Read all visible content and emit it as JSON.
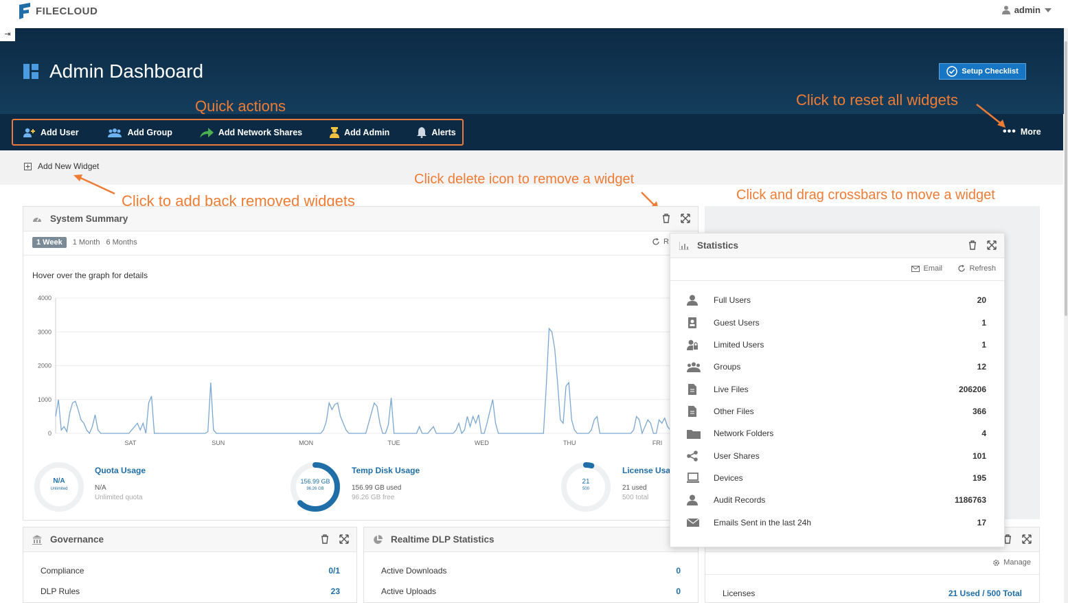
{
  "app": {
    "logo_text": "FILECLOUD",
    "user": "admin"
  },
  "hero": {
    "title": "Admin Dashboard",
    "setup_label": "Setup Checklist"
  },
  "quick_actions": [
    {
      "label": "Add User",
      "icon": "add-user-icon"
    },
    {
      "label": "Add Group",
      "icon": "add-group-icon"
    },
    {
      "label": "Add Network Shares",
      "icon": "network-share-icon"
    },
    {
      "label": "Add Admin",
      "icon": "admin-icon"
    },
    {
      "label": "Alerts",
      "icon": "bell-icon"
    }
  ],
  "more_label": "More",
  "add_widget_label": "Add New Widget",
  "annotations": {
    "quick_actions": "Quick actions",
    "reset": "Click to reset all widgets",
    "delete": "Click delete icon to remove a widget",
    "add_back": "Click to add back removed widgets",
    "drag": "Click and drag crossbars to move a widget"
  },
  "system_summary": {
    "title": "System Summary",
    "tabs": [
      "1 Week",
      "1 Month",
      "6 Months"
    ],
    "refresh_label": "R",
    "hover_note": "Hover over the graph for details",
    "gauges": [
      {
        "title": "Quota Usage",
        "center": "N/A",
        "center_sub": "Unlimited",
        "line1": "N/A",
        "line2": "Unlimited quota",
        "fraction": 0
      },
      {
        "title": "Temp Disk Usage",
        "center": "156.99 GB",
        "center_sub": "96.26 GB",
        "line1": "156.99 GB used",
        "line2": "96.26 GB free",
        "fraction": 0.62
      },
      {
        "title": "License Usa",
        "center": "21",
        "center_sub": "500",
        "line1": "21 used",
        "line2": "500 total",
        "fraction": 0.042
      }
    ]
  },
  "chart_data": {
    "type": "line",
    "title": "",
    "xlabel": "",
    "ylabel": "",
    "ylim": [
      0,
      4000
    ],
    "yticks": [
      0,
      1000,
      2000,
      3000,
      4000
    ],
    "xticks": [
      "SAT",
      "SUN",
      "MON",
      "TUE",
      "WED",
      "THU",
      "FRI"
    ],
    "color": "#7aa7d2",
    "grid": true,
    "series": [
      {
        "values": [
          500,
          1000,
          100,
          200,
          50,
          600,
          900,
          950,
          700,
          400,
          300,
          100,
          0,
          200,
          550,
          100,
          0,
          0,
          0,
          0,
          0,
          0,
          0,
          0,
          0,
          0,
          0,
          100,
          200,
          300,
          100,
          300,
          0,
          900,
          1100,
          0,
          0,
          0,
          0,
          0,
          0,
          0,
          0,
          0,
          0,
          0,
          0,
          0,
          0,
          0,
          0,
          0,
          0,
          0,
          50,
          1500,
          100,
          0,
          0,
          0,
          0,
          0,
          0,
          0,
          0,
          0,
          0,
          0,
          0,
          0,
          0,
          0,
          0,
          0,
          0,
          0,
          0,
          0,
          0,
          0,
          0,
          0,
          0,
          0,
          0,
          0,
          0,
          0,
          0,
          0,
          0,
          0,
          0,
          0,
          0,
          100,
          350,
          900,
          700,
          850,
          900,
          500,
          300,
          100,
          0,
          0,
          0,
          0,
          0,
          0,
          0,
          300,
          600,
          900,
          800,
          300,
          0,
          0,
          250,
          1050,
          0,
          0,
          0,
          0,
          0,
          0,
          0,
          0,
          0,
          200,
          0,
          0,
          0,
          100,
          200,
          0,
          0,
          0,
          0,
          0,
          0,
          0,
          100,
          300,
          0,
          100,
          500,
          200,
          500,
          300,
          550,
          0,
          0,
          300,
          650,
          1000,
          300,
          0,
          0,
          0,
          0,
          0,
          0,
          0,
          0,
          0,
          0,
          0,
          0,
          0,
          0,
          0,
          0,
          0,
          1400,
          3100,
          3000,
          2500,
          1500,
          400,
          300,
          1400,
          1500,
          400,
          100,
          0,
          0,
          0,
          0,
          0,
          100,
          400,
          500,
          0,
          0,
          0,
          0,
          0,
          0,
          0,
          0,
          0,
          0,
          0,
          0,
          100,
          500,
          400,
          0,
          200,
          400,
          300,
          0,
          0,
          400,
          300,
          450,
          200,
          100
        ]
      }
    ]
  },
  "statistics": {
    "title": "Statistics",
    "email_label": "Email",
    "refresh_label": "Refresh",
    "rows": [
      {
        "label": "Full Users",
        "value": "20",
        "icon": "user-icon"
      },
      {
        "label": "Guest Users",
        "value": "1",
        "icon": "guest-icon"
      },
      {
        "label": "Limited Users",
        "value": "1",
        "icon": "limited-user-icon"
      },
      {
        "label": "Groups",
        "value": "12",
        "icon": "group-icon"
      },
      {
        "label": "Live Files",
        "value": "206206",
        "icon": "file-icon"
      },
      {
        "label": "Other Files",
        "value": "366",
        "icon": "file-icon"
      },
      {
        "label": "Network Folders",
        "value": "4",
        "icon": "folder-icon"
      },
      {
        "label": "User Shares",
        "value": "101",
        "icon": "share-icon"
      },
      {
        "label": "Devices",
        "value": "195",
        "icon": "device-icon"
      },
      {
        "label": "Audit Records",
        "value": "1186763",
        "icon": "user-icon"
      },
      {
        "label": "Emails Sent in the last 24h",
        "value": "17",
        "icon": "mail-icon"
      }
    ]
  },
  "governance": {
    "title": "Governance",
    "rows": [
      {
        "label": "Compliance",
        "value": "0/1"
      },
      {
        "label": "DLP Rules",
        "value": "23"
      }
    ]
  },
  "dlp": {
    "title": "Realtime DLP Statistics",
    "rows": [
      {
        "label": "Active Downloads",
        "value": "0"
      },
      {
        "label": "Active Uploads",
        "value": "0"
      }
    ]
  },
  "license": {
    "manage_label": "Manage",
    "rows": [
      {
        "label": "Licenses",
        "value": "21 Used / 500 Total"
      }
    ]
  }
}
